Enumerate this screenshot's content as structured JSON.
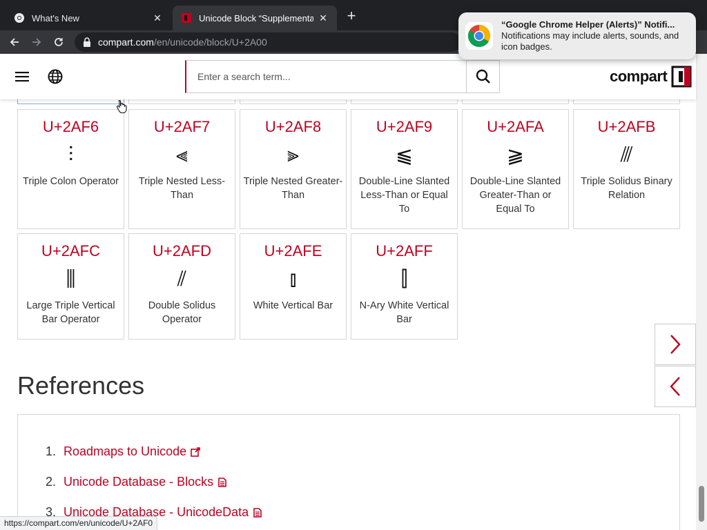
{
  "browser": {
    "tabs": [
      {
        "title": "What's New",
        "active": false
      },
      {
        "title": "Unicode Block “Supplemental Mathematical Operators”",
        "active": true
      }
    ],
    "url_host": "compart.com",
    "url_path": "/en/unicode/block/U+2A00",
    "status_url": "https://compart.com/en/unicode/U+2AF0"
  },
  "notification": {
    "title": "“Google Chrome Helper (Alerts)” Notifi...",
    "body": "Notifications may include alerts, sounds, and icon badges."
  },
  "header": {
    "search_placeholder": "Enter a search term...",
    "logo_text": "compart"
  },
  "characters": [
    {
      "code": "U+2AF6",
      "glyph": "⫶",
      "name": "Triple Colon Operator"
    },
    {
      "code": "U+2AF7",
      "glyph": "⫷",
      "name": "Triple Nested Less-Than"
    },
    {
      "code": "U+2AF8",
      "glyph": "⫸",
      "name": "Triple Nested Greater-Than"
    },
    {
      "code": "U+2AF9",
      "glyph": "⫹",
      "name": "Double-Line Slanted Less-Than or Equal To"
    },
    {
      "code": "U+2AFA",
      "glyph": "⫺",
      "name": "Double-Line Slanted Greater-Than or Equal To"
    },
    {
      "code": "U+2AFB",
      "glyph": "⫻",
      "name": "Triple Solidus Binary Relation"
    },
    {
      "code": "U+2AFC",
      "glyph": "⫼",
      "name": "Large Triple Vertical Bar Operator"
    },
    {
      "code": "U+2AFD",
      "glyph": "⫽",
      "name": "Double Solidus Operator"
    },
    {
      "code": "U+2AFE",
      "glyph": "⫾",
      "name": "White Vertical Bar"
    },
    {
      "code": "U+2AFF",
      "glyph": "⫿",
      "name": "N-Ary White Vertical Bar"
    }
  ],
  "references": {
    "title": "References",
    "items": [
      {
        "num": "1.",
        "label": "Roadmaps to Unicode",
        "icon": "external-link-icon"
      },
      {
        "num": "2.",
        "label": "Unicode Database - Blocks",
        "icon": "document-icon"
      },
      {
        "num": "3.",
        "label": "Unicode Database - UnicodeData",
        "icon": "document-icon"
      }
    ]
  },
  "colors": {
    "accent": "#c00020",
    "border": "#d6d6d6"
  }
}
